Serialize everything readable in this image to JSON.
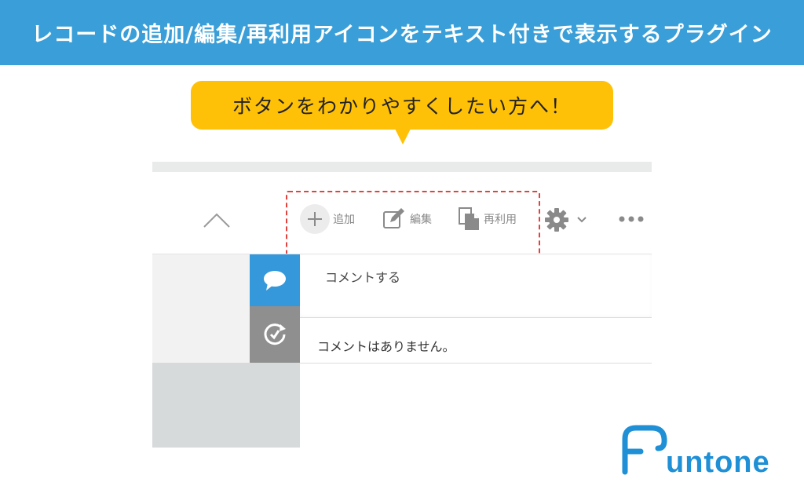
{
  "banner": {
    "title": "レコードの追加/編集/再利用アイコンをテキスト付きで表示するプラグイン"
  },
  "callout": {
    "text": "ボタンをわかりやすくしたい方へ！"
  },
  "toolbar": {
    "add_label": "追加",
    "edit_label": "編集",
    "reuse_label": "再利用"
  },
  "sidebar": {
    "comment_tab_icon": "speech-bubble-icon",
    "history_tab_icon": "history-clock-icon"
  },
  "comments": {
    "input_placeholder": "コメントする",
    "empty_message": "コメントはありません。"
  },
  "logo": {
    "text": "Fun tone"
  },
  "colors": {
    "banner": "#3a9fd8",
    "callout": "#ffc107",
    "highlight_border": "#e0433e",
    "comment_tab": "#3498db",
    "history_tab": "#8f8f8f",
    "logo": "#1f8fd6"
  }
}
